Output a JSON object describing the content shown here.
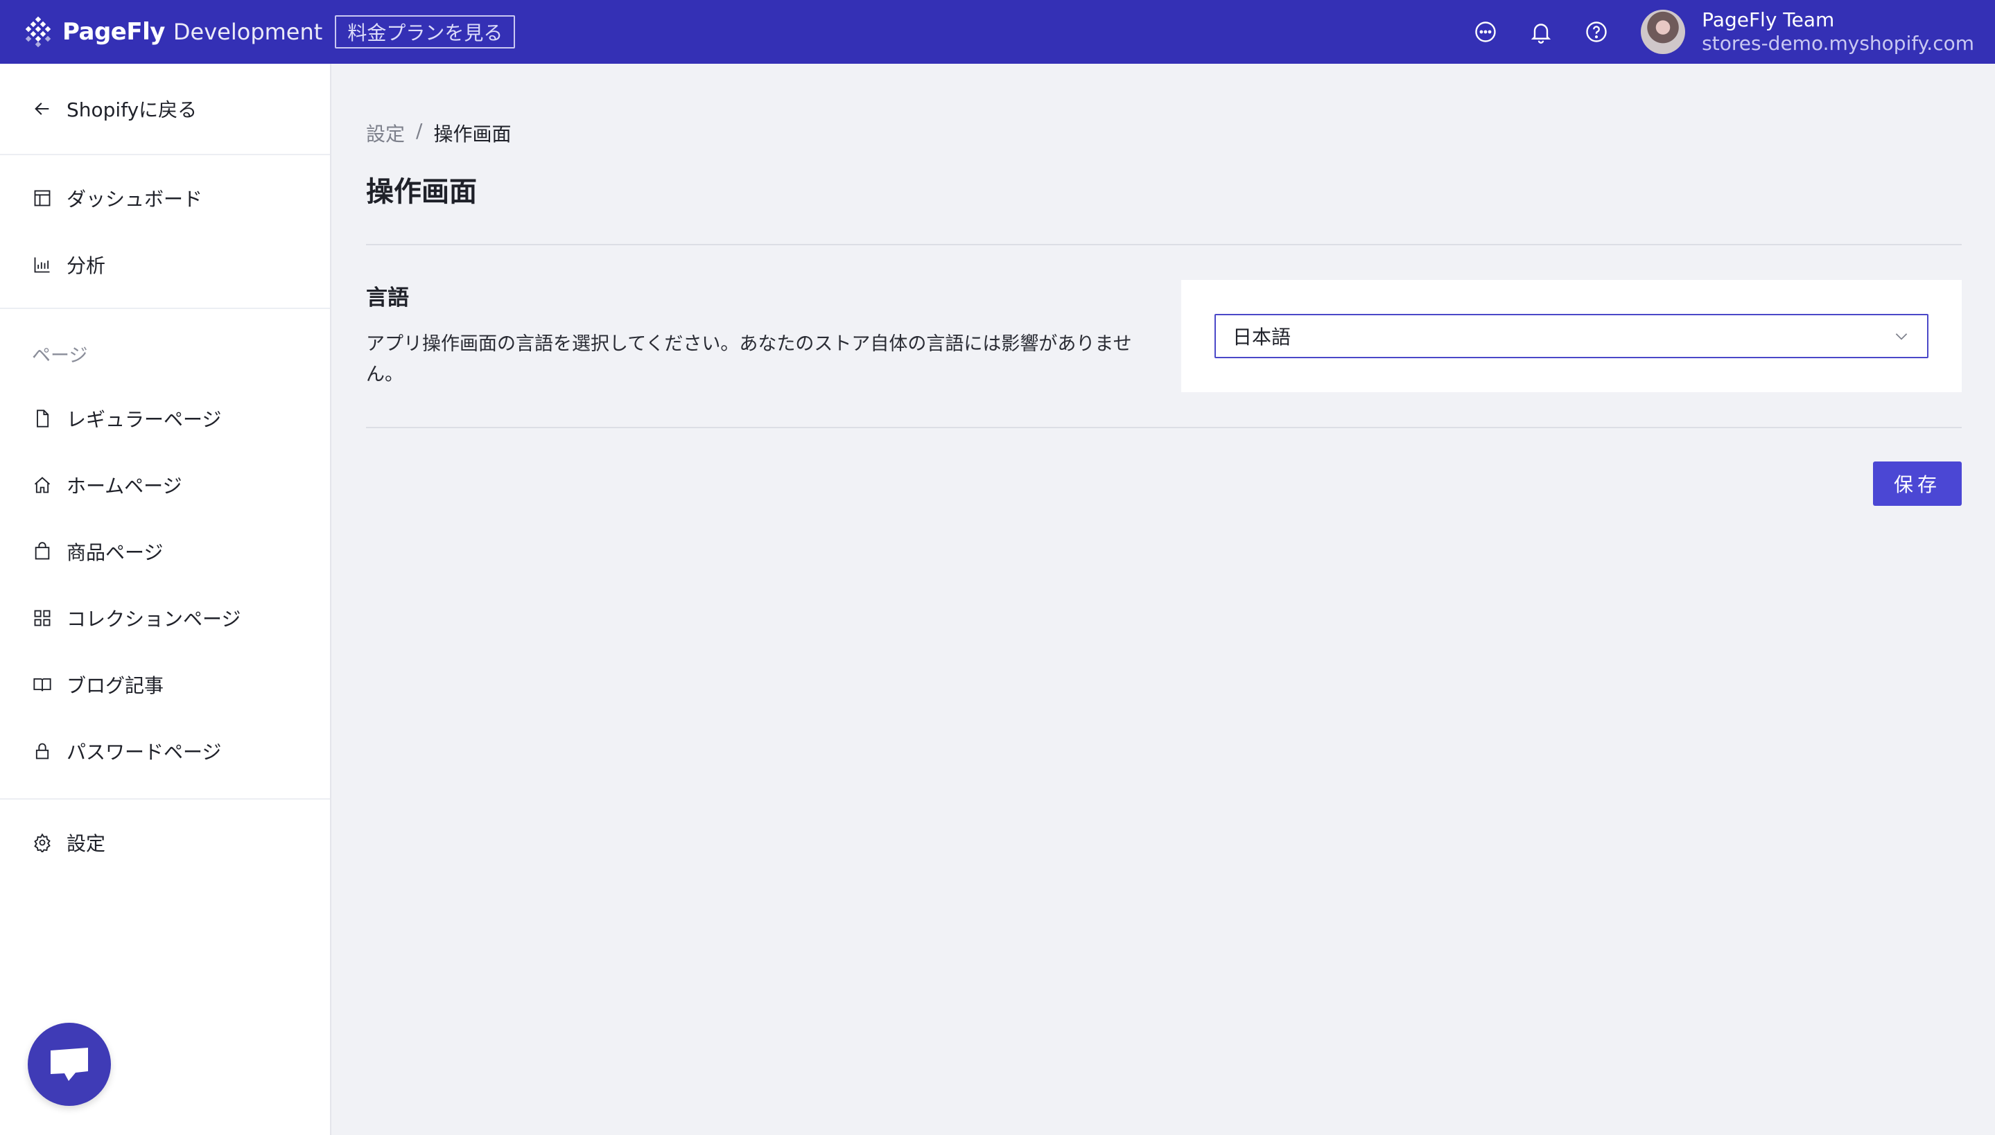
{
  "topbar": {
    "brand_name": "PageFly",
    "brand_env": "Development",
    "plan_button": "料金プランを見る",
    "user_name": "PageFly Team",
    "user_store": "stores-demo.myshopify.com",
    "icons": [
      "chat-bubble-icon",
      "bell-icon",
      "help-icon"
    ]
  },
  "sidebar": {
    "back": "Shopifyに戻る",
    "items_top": [
      {
        "label": "ダッシュボード",
        "icon": "dashboard-icon"
      },
      {
        "label": "分析",
        "icon": "analytics-icon"
      }
    ],
    "pages_title": "ページ",
    "page_items": [
      {
        "label": "レギュラーページ",
        "icon": "file-icon"
      },
      {
        "label": "ホームページ",
        "icon": "home-icon"
      },
      {
        "label": "商品ページ",
        "icon": "bag-icon"
      },
      {
        "label": "コレクションページ",
        "icon": "grid-icon"
      },
      {
        "label": "ブログ記事",
        "icon": "book-icon"
      },
      {
        "label": "パスワードページ",
        "icon": "lock-icon"
      }
    ],
    "settings": "設定"
  },
  "main": {
    "breadcrumb": {
      "parent": "設定",
      "separator": "/",
      "current": "操作画面"
    },
    "title": "操作画面",
    "language": {
      "label": "言語",
      "description": "アプリ操作画面の言語を選択してください。あなたのストア自体の言語には影響がありません。",
      "selected": "日本語"
    },
    "save_label": "保存"
  },
  "colors": {
    "topbar": "#3430b5",
    "accent": "#4b47d4"
  }
}
